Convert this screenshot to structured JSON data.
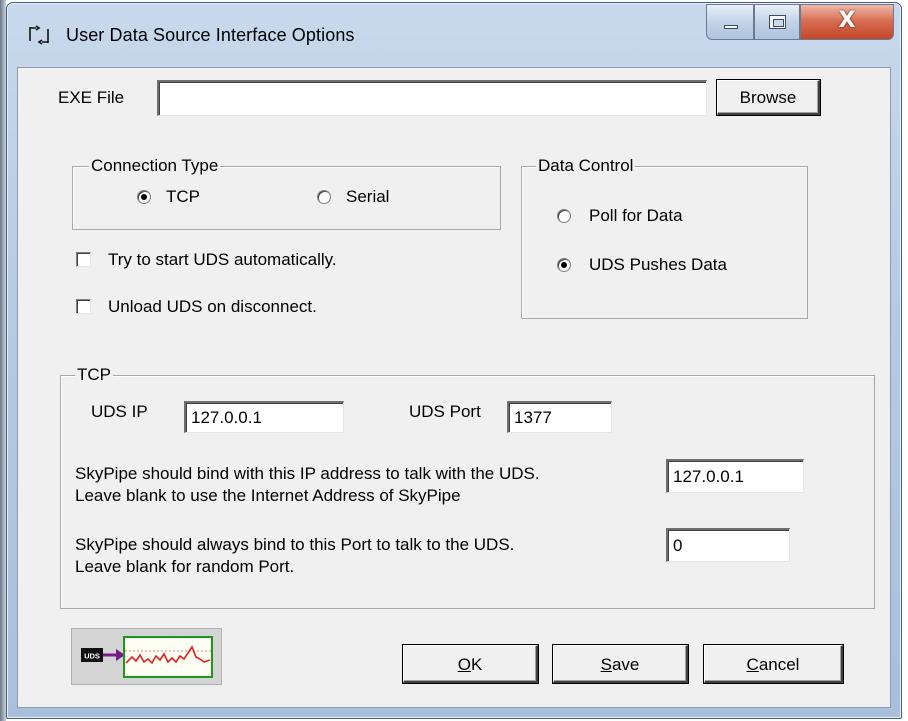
{
  "window": {
    "title": "User Data Source Interface Options",
    "close_glyph": "X"
  },
  "exe": {
    "label": "EXE File",
    "value": "",
    "browse_label": "Browse"
  },
  "connection_type": {
    "title": "Connection Type",
    "options": [
      {
        "label": "TCP",
        "checked": true
      },
      {
        "label": "Serial",
        "checked": false
      }
    ]
  },
  "data_control": {
    "title": "Data Control",
    "options": [
      {
        "label": "Poll for Data",
        "checked": false
      },
      {
        "label": "UDS Pushes Data",
        "checked": true
      }
    ]
  },
  "checkboxes": [
    {
      "label": "Try to start UDS automatically.",
      "checked": false
    },
    {
      "label": "Unload UDS on disconnect.",
      "checked": false
    }
  ],
  "tcp": {
    "title": "TCP",
    "uds_ip_label": "UDS IP",
    "uds_ip_value": "127.0.0.1",
    "uds_port_label": "UDS Port",
    "uds_port_value": "1377",
    "bind_ip_text_1": "SkyPipe should bind with this IP address to talk with the UDS.",
    "bind_ip_text_2": "Leave blank to use the Internet Address of SkyPipe",
    "bind_ip_value": "127.0.0.1",
    "bind_port_text_1": "SkyPipe should always bind to this Port to talk to the UDS.",
    "bind_port_text_2": "Leave blank for random Port.",
    "bind_port_value": "0"
  },
  "logo": {
    "badge_text": "UDS",
    "icon_name": "uds-to-chart-logo"
  },
  "buttons": {
    "ok_mnemonic": "O",
    "ok_rest": "K",
    "save_mnemonic": "S",
    "save_rest": "ave",
    "cancel_mnemonic": "C",
    "cancel_rest": "ancel"
  },
  "colors": {
    "title_gradient_top": "#c9d9ec",
    "close_button": "#c2462a",
    "dialog_face": "#f0f0f0",
    "logo_arrow": "#7a1a8a",
    "logo_chart_line": "#e02020",
    "logo_chart_border": "#1a9a1a"
  }
}
